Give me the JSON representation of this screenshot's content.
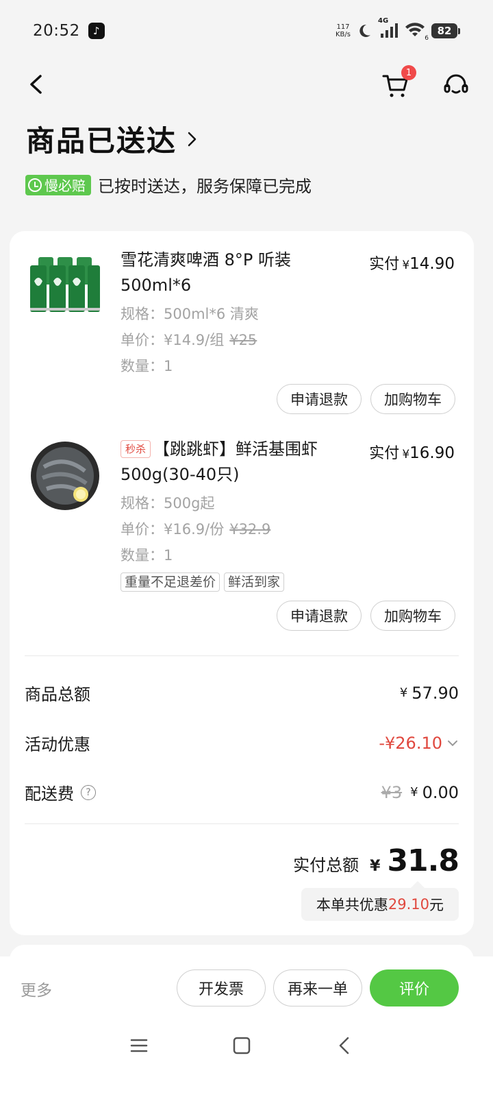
{
  "status_bar": {
    "time": "20:52",
    "net_speed_value": "117",
    "net_speed_unit": "KB/s",
    "network": "4G",
    "wifi_level": "6",
    "battery": "82"
  },
  "nav": {
    "cart_count": "1"
  },
  "header": {
    "title": "商品已送达",
    "guarantee_badge": "慢必赔",
    "guarantee_text": "已按时送达，服务保障已完成"
  },
  "items": [
    {
      "name": "雪花清爽啤酒 8°P 听装 500ml*6",
      "flash_tag": "",
      "paid_label": "实付",
      "paid_currency": "¥",
      "paid_amount": "14.90",
      "spec": "规格：500ml*6 清爽",
      "unit_price": "单价：¥14.9/组",
      "original_price": "¥25",
      "quantity": "数量：1",
      "tags": [],
      "refund_label": "申请退款",
      "add_cart_label": "加购物车"
    },
    {
      "name": "【跳跳虾】鲜活基围虾500g(30-40只)",
      "flash_tag": "秒杀",
      "paid_label": "实付",
      "paid_currency": "¥",
      "paid_amount": "16.90",
      "spec": "规格：500g起",
      "unit_price": "单价：¥16.9/份",
      "original_price": "¥32.9",
      "quantity": "数量：1",
      "tags": [
        "重量不足退差价",
        "鲜活到家"
      ],
      "refund_label": "申请退款",
      "add_cart_label": "加购物车"
    }
  ],
  "summary": {
    "goods_total_label": "商品总额",
    "goods_total_currency": "¥",
    "goods_total_value": "57.90",
    "discount_label": "活动优惠",
    "discount_value": "-¥26.10",
    "delivery_label": "配送费",
    "delivery_help": "?",
    "delivery_original": "¥3",
    "delivery_currency": "¥",
    "delivery_value": "0.00",
    "total_label": "实付总额",
    "total_currency": "¥",
    "total_value": "31.8",
    "saving_prefix": "本单共优惠",
    "saving_amount": "29.10",
    "saving_suffix": "元"
  },
  "bottom_bar": {
    "more_label": "更多",
    "invoice_label": "开发票",
    "reorder_label": "再来一单",
    "review_label": "评价"
  },
  "colors": {
    "accent_green": "#54c844",
    "discount_red": "#e0483e",
    "badge_red": "#f04a4a"
  },
  "icons": [
    "back-arrow-icon",
    "cart-icon",
    "customer-service-icon",
    "chevron-right-icon",
    "clock-icon",
    "help-icon",
    "chevron-down-icon",
    "menu-icon",
    "home-square-icon",
    "back-triangle-icon"
  ]
}
